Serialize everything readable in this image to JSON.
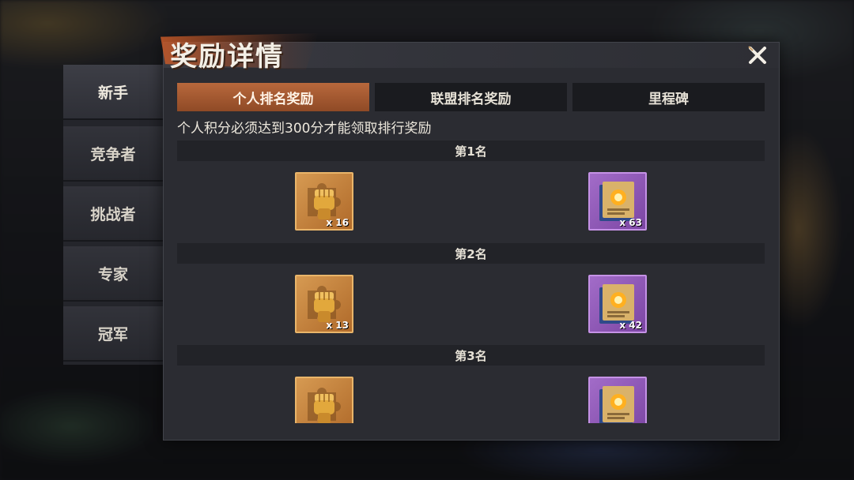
{
  "panel": {
    "title": "奖励详情",
    "close_icon": "close-x-icon"
  },
  "side_menu": [
    {
      "label": "新手",
      "active": true
    },
    {
      "label": "竞争者",
      "active": false
    },
    {
      "label": "挑战者",
      "active": false
    },
    {
      "label": "专家",
      "active": false
    },
    {
      "label": "冠军",
      "active": false
    }
  ],
  "tabs": [
    {
      "label": "个人排名奖励",
      "active": true
    },
    {
      "label": "联盟排名奖励",
      "active": false
    },
    {
      "label": "里程碑",
      "active": false
    }
  ],
  "requirement_text": "个人积分必须达到300分才能领取排行奖励",
  "ranks": [
    {
      "label": "第1名",
      "rewards": [
        {
          "icon": "fist-puzzle-piece-icon",
          "rarity": "gold",
          "quantity": "x 16"
        },
        {
          "icon": "skill-book-icon",
          "rarity": "purple",
          "quantity": "x 63"
        }
      ]
    },
    {
      "label": "第2名",
      "rewards": [
        {
          "icon": "fist-puzzle-piece-icon",
          "rarity": "gold",
          "quantity": "x 13"
        },
        {
          "icon": "skill-book-icon",
          "rarity": "purple",
          "quantity": "x 42"
        }
      ]
    },
    {
      "label": "第3名",
      "rewards": [
        {
          "icon": "fist-puzzle-piece-icon",
          "rarity": "gold",
          "quantity": ""
        },
        {
          "icon": "skill-book-icon",
          "rarity": "purple",
          "quantity": ""
        }
      ]
    }
  ],
  "colors": {
    "active_tab": "#b8683c",
    "gold_rarity": "#d69a52",
    "purple_rarity": "#a26cc8"
  }
}
